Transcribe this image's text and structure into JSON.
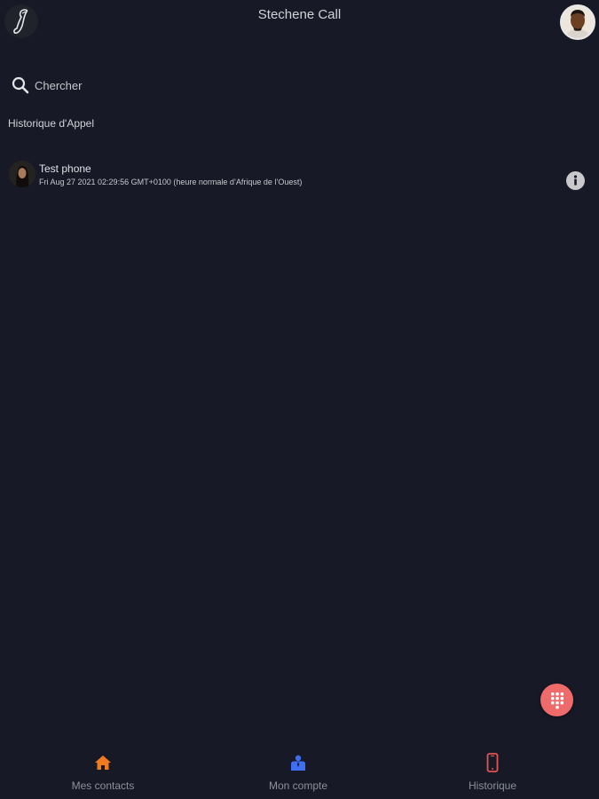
{
  "header": {
    "title": "Stechene Call",
    "logo_icon": "phone-handset-icon",
    "profile_icon": "profile-avatar"
  },
  "search": {
    "placeholder": "Chercher",
    "value": "",
    "icon": "search-icon"
  },
  "history": {
    "section_title": "Historique d'Appel",
    "items": [
      {
        "name": "Test phone",
        "date": "Fri Aug 27 2021 02:29:56 GMT+0100 (heure normale d’Afrique de l’Ouest)",
        "action_icon": "info-icon"
      }
    ]
  },
  "fab": {
    "icon": "dialpad-icon",
    "color": "#ef6b6b"
  },
  "bottom_nav": {
    "items": [
      {
        "label": "Mes contacts",
        "icon": "home-icon",
        "color": "#f07a1f"
      },
      {
        "label": "Mon compte",
        "icon": "account-icon",
        "color": "#3d6ff0"
      },
      {
        "label": "Historique",
        "icon": "mobile-phone-icon",
        "color": "#e05454"
      }
    ]
  },
  "colors": {
    "background": "#171a26",
    "text": "#d7d9de"
  }
}
